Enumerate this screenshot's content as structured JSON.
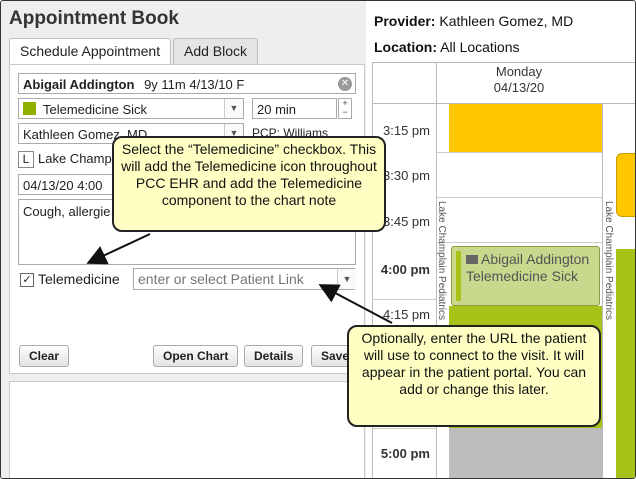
{
  "app": {
    "title": "Appointment Book"
  },
  "tabs": [
    {
      "label": "Schedule Appointment"
    },
    {
      "label": "Add Block"
    }
  ],
  "patient": {
    "name": "Abigail Addington",
    "details": "9y 11m  4/13/10  F"
  },
  "appt_type": {
    "value": "Telemedicine Sick",
    "color": "#8fb000"
  },
  "duration": {
    "value": "20 min"
  },
  "provider_select": {
    "value": "Kathleen Gomez, MD"
  },
  "pcp": {
    "label": "PCP:",
    "value": "Williams"
  },
  "location_code": "L",
  "location_value": "Lake Champl",
  "date_time": "04/13/20  4:00",
  "complaint": "Cough, allergie",
  "telemedicine": {
    "label": "Telemedicine",
    "checked": true,
    "check_glyph": "✓"
  },
  "patient_link": {
    "placeholder": "enter or select Patient Link"
  },
  "buttons": {
    "clear": "Clear",
    "open_chart": "Open Chart",
    "details": "Details",
    "save": "Save"
  },
  "header": {
    "provider_label": "Provider:",
    "provider_value": "Kathleen Gomez, MD",
    "location_label": "Location:",
    "location_value": "All Locations"
  },
  "calendar": {
    "day": "Monday",
    "date": "04/13/20",
    "times": [
      {
        "label": "3:15 pm"
      },
      {
        "label": "3:30 pm"
      },
      {
        "label": "3:45 pm"
      },
      {
        "label": "4:00 pm"
      },
      {
        "label": "4:15 pm"
      },
      {
        "label": "5:00 pm"
      }
    ],
    "column_label": "Lake Champlain Pediatrics",
    "appointment": {
      "name": "Abigail Addington",
      "type": "Telemedicine Sick"
    },
    "colors": {
      "yellow": "#ffc700",
      "green": "#a8c219",
      "gray": "#bdbdbd",
      "appt_bg": "#c8d88d"
    }
  },
  "callouts": {
    "telemedicine_tip": "Select the “Telemedicine” checkbox. This will add the Telemedicine icon throughout PCC EHR and add the Telemedicine component to the chart note",
    "link_tip": "Optionally, enter the URL the patient will use to connect to the visit. It will appear in the patient portal. You can add or change this later."
  }
}
